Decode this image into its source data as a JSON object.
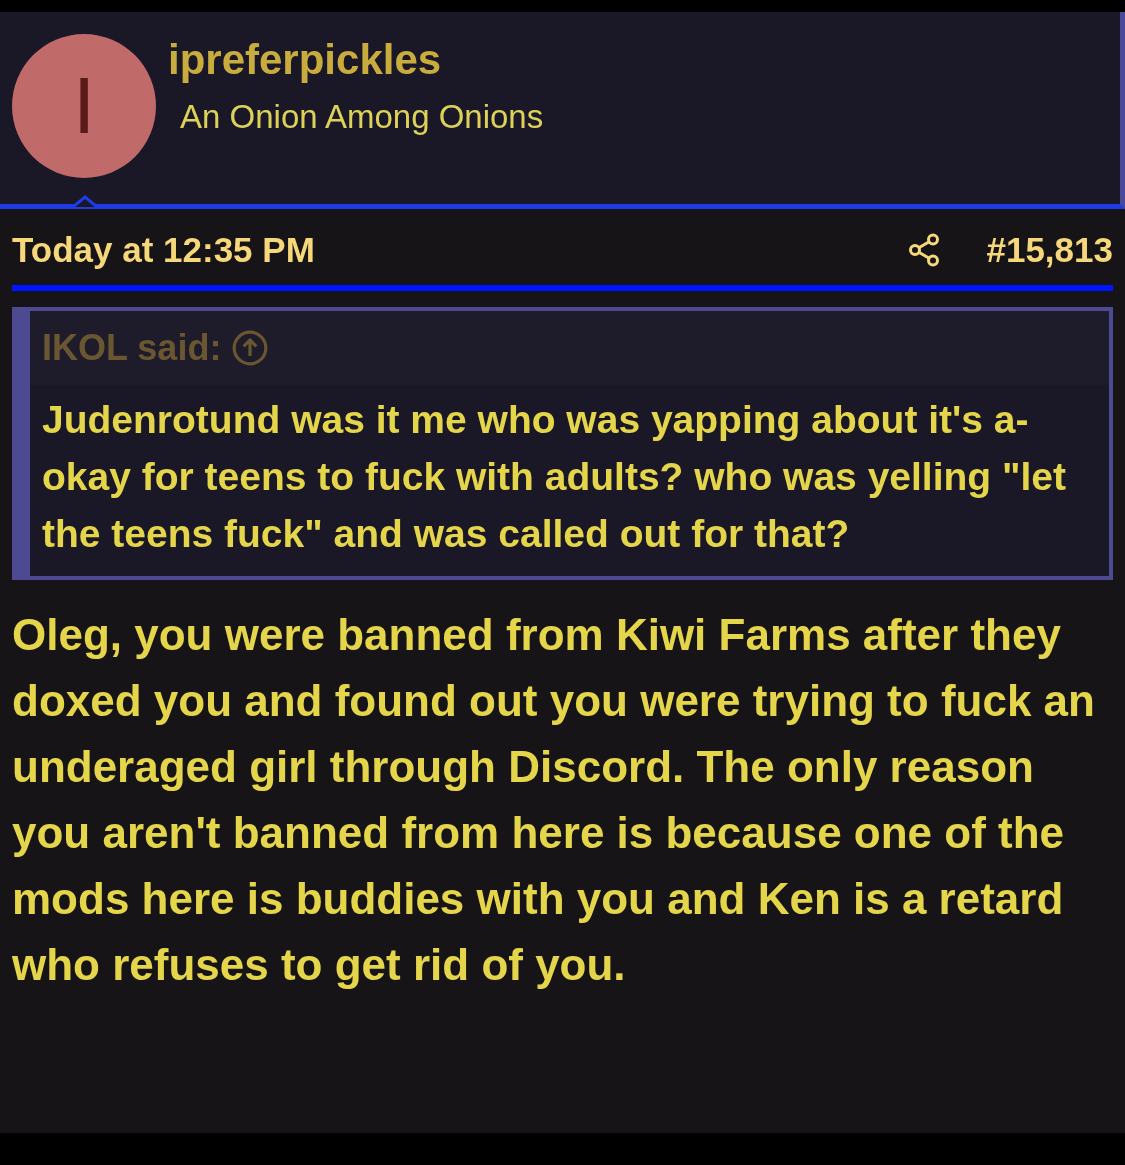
{
  "author": {
    "avatar_letter": "I",
    "username": "ipreferpickles",
    "title": "An Onion Among Onions"
  },
  "post": {
    "timestamp": "Today at 12:35 PM",
    "number": "#15,813",
    "quote": {
      "attribution": "IKOL said:",
      "text": "Judenrotund was it me who was yapping about it's a-okay for teens to fuck with adults? who was yelling \"let the teens fuck\" and was called out for that?"
    },
    "body": "Oleg, you were banned from Kiwi Farms after they doxed you and found out you were trying to fuck an underaged girl through Discord. The only reason you aren't banned from here is because one of the mods here is buddies with you and Ken is a retard who refuses to get rid of you."
  }
}
